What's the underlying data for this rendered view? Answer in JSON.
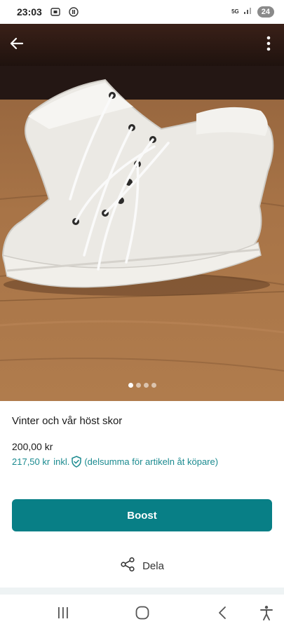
{
  "status_bar": {
    "time": "23:03",
    "network": "5G",
    "battery": "24",
    "icons": [
      "screenshot-icon",
      "notification-icon",
      "signal-icon"
    ]
  },
  "header": {
    "back_icon": "arrow-left-icon",
    "menu_icon": "more-vertical-icon"
  },
  "gallery": {
    "image_count": 4,
    "active_index": 0
  },
  "product": {
    "title": "Vinter och vår höst skor",
    "price": "200,00 kr",
    "total_price": "217,50 kr",
    "total_incl": "inkl.",
    "total_note": "(delsumma för artikeln åt köpare)",
    "shield_icon": "shield-check-icon"
  },
  "actions": {
    "boost_label": "Boost",
    "share_label": "Dela",
    "share_icon": "share-icon"
  },
  "colors": {
    "accent": "#087f86",
    "accent_text": "#1a8a8f"
  },
  "system_nav": {
    "icons": [
      "recents-icon",
      "home-icon",
      "back-icon",
      "accessibility-icon"
    ]
  }
}
